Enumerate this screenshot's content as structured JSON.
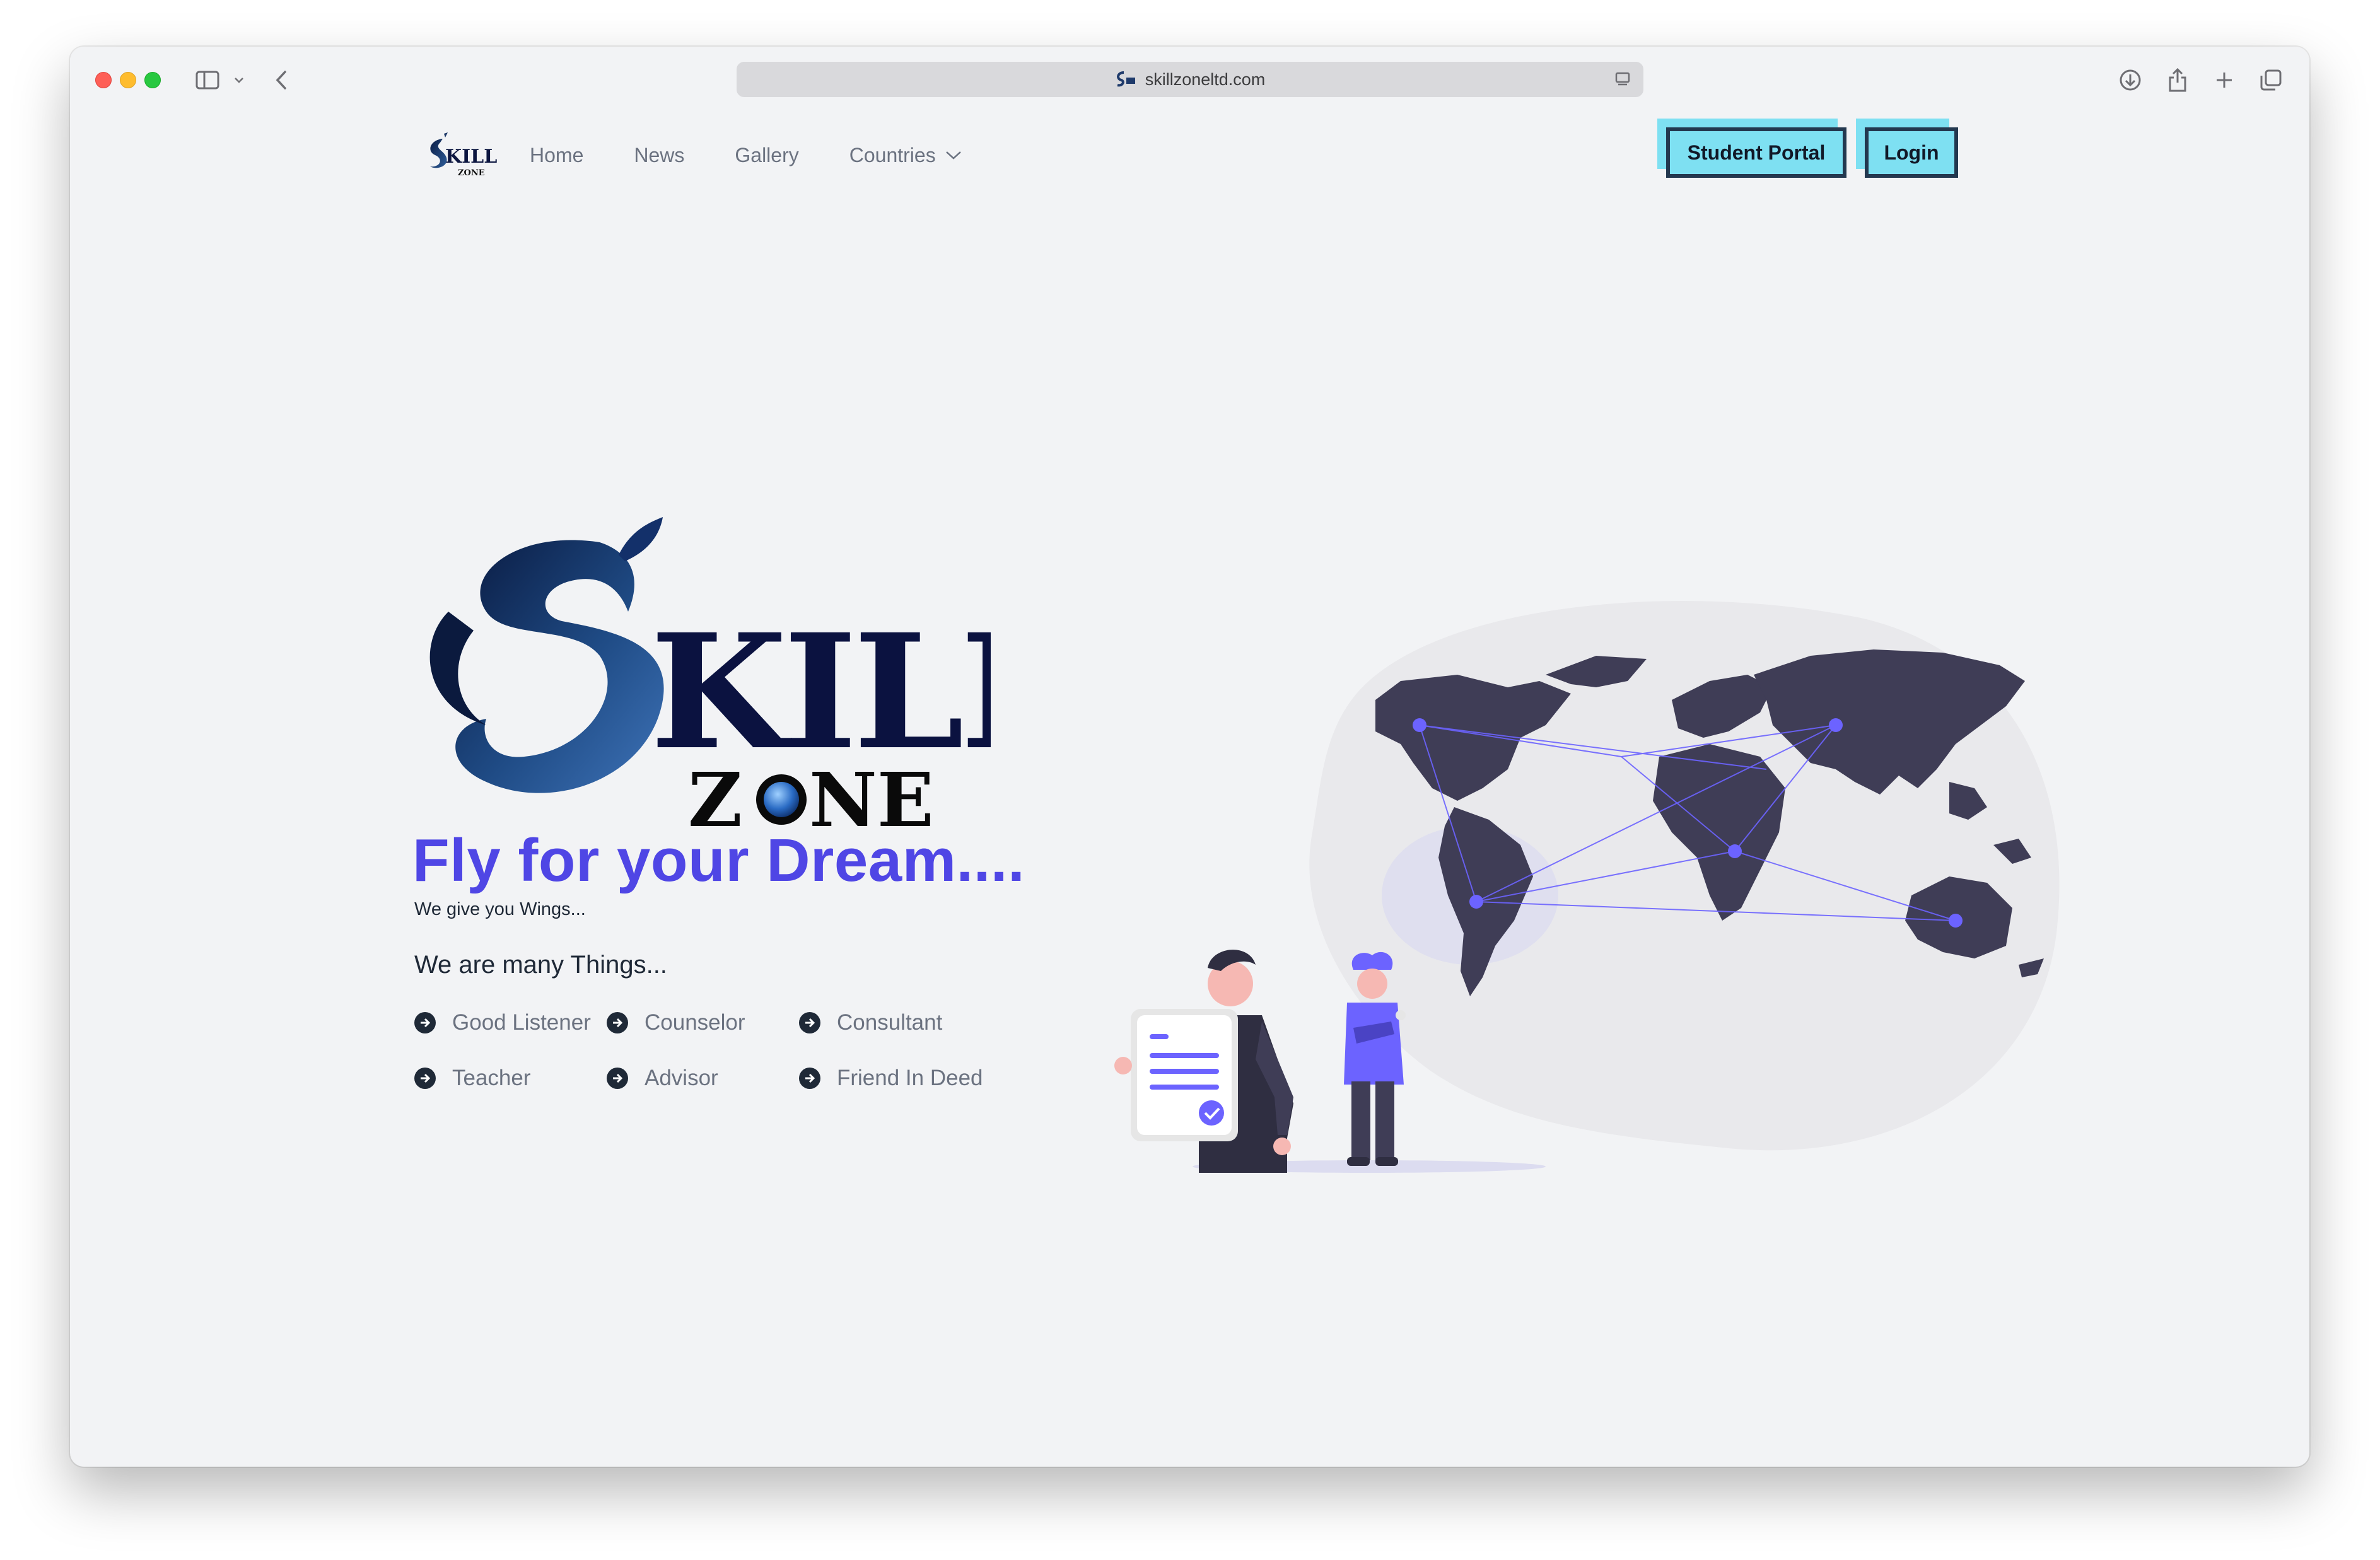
{
  "browser": {
    "url": "skillzoneltd.com"
  },
  "nav": {
    "logo_text": "SKILL ZONE",
    "links": [
      {
        "label": "Home"
      },
      {
        "label": "News"
      },
      {
        "label": "Gallery"
      },
      {
        "label": "Countries"
      }
    ],
    "student_portal_label": "Student Portal",
    "login_label": "Login"
  },
  "hero": {
    "logo_main": "KILL",
    "logo_sub_left": "Z",
    "logo_sub_right": "NE",
    "tagline": "Fly for your Dream....",
    "subtagline": "We give you Wings...",
    "many_heading": "We are many Things...",
    "things": [
      "Good Listener",
      "Counselor",
      "Consultant",
      "Teacher",
      "Advisor",
      "Friend In Deed"
    ]
  },
  "colors": {
    "accent": "#4f46e5",
    "button_bg": "#7ee0f2",
    "button_border": "#23384f",
    "logo_navy": "#1a2f6b"
  }
}
